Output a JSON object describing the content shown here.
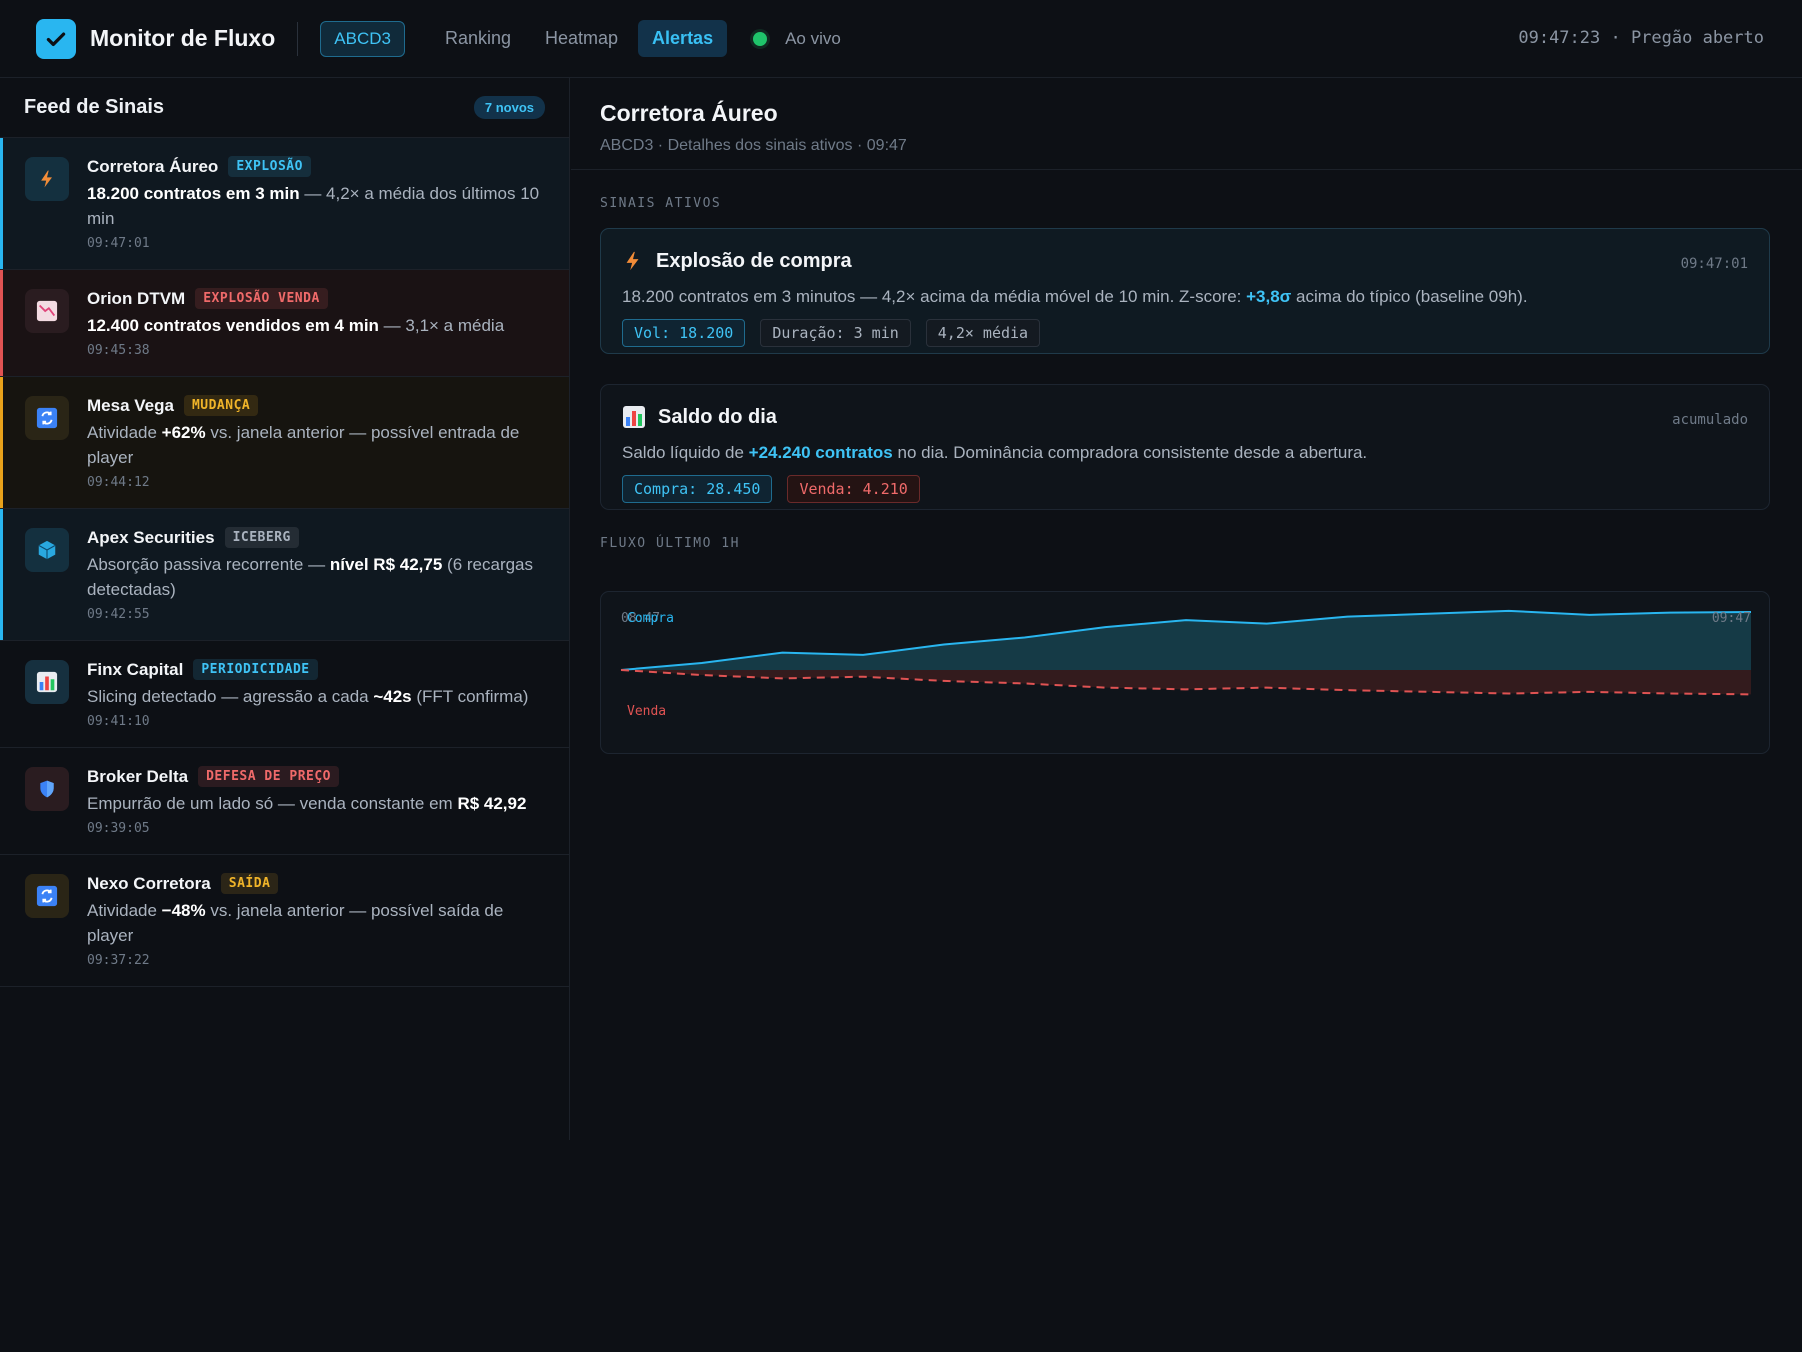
{
  "header": {
    "app_title": "Monitor de Fluxo",
    "ticker": "ABCD3",
    "nav": [
      "Ranking",
      "Heatmap",
      "Alertas"
    ],
    "active_nav": "Alertas",
    "live_label": "Ao vivo",
    "clock": "09:47:23 · Pregão aberto"
  },
  "feed": {
    "title": "Feed de Sinais",
    "new_badge": "7 novos",
    "items": [
      {
        "name": "Corretora Áureo",
        "tag": "EXPLOSÃO",
        "tag_color": "#3fc3f5",
        "accent": "#29b6f0",
        "icon": "lightning-icon",
        "pre": "",
        "bold": "18.200 contratos em 3 min",
        "post": " — 4,2× a média dos últimos 10 min",
        "time": "09:47:01"
      },
      {
        "name": "Orion DTVM",
        "tag": "EXPLOSÃO VENDA",
        "tag_color": "#f06a6a",
        "accent": "#e05353",
        "icon": "chart-down-icon",
        "pre": "",
        "bold": "12.400 contratos vendidos em 4 min",
        "post": " — 3,1× a média",
        "time": "09:45:38"
      },
      {
        "name": "Mesa Vega",
        "tag": "MUDANÇA",
        "tag_color": "#f0b429",
        "accent": "#e8a21b",
        "icon": "refresh-icon",
        "pre": "Atividade ",
        "bold": "+62%",
        "post": " vs. janela anterior — possível entrada de player",
        "time": "09:44:12"
      },
      {
        "name": "Apex Securities",
        "tag": "ICEBERG",
        "tag_color": "#aab3bf",
        "accent": "#29b6f0",
        "icon": "cube-icon",
        "pre": "Absorção passiva recorrente — ",
        "bold": "nível R$ 42,75",
        "post": " (6 recargas detectadas)",
        "time": "09:42:55"
      },
      {
        "name": "Finx Capital",
        "tag": "PERIODICIDADE",
        "tag_color": "#3fc3f5",
        "accent": "",
        "icon": "bar-chart-icon",
        "pre": "Slicing detectado — agressão a cada ",
        "bold": "~42s",
        "post": " (FFT confirma)",
        "time": "09:41:10"
      },
      {
        "name": "Broker Delta",
        "tag": "DEFESA DE PREÇO",
        "tag_color": "#f06a6a",
        "accent": "",
        "icon": "shield-icon",
        "pre": "Empurrão de um lado só — venda constante em ",
        "bold": "R$ 42,92",
        "post": "",
        "time": "09:39:05"
      },
      {
        "name": "Nexo Corretora",
        "tag": "SAÍDA",
        "tag_color": "#f0b429",
        "accent": "",
        "icon": "refresh-icon",
        "pre": "Atividade ",
        "bold": "−48%",
        "post": " vs. janela anterior — possível saída de player",
        "time": "09:37:22"
      }
    ]
  },
  "detail": {
    "title": "Corretora Áureo",
    "subtitle": "ABCD3 · Detalhes dos sinais ativos · 09:47",
    "section_active": "SINAIS ATIVOS",
    "card1": {
      "title": "Explosão de compra",
      "time": "09:47:01",
      "text_pre": "18.200 contratos em 3 minutos — 4,2× acima da média móvel de 10 min. Z-score: ",
      "text_bold": "+3,8σ",
      "text_post": " acima do típico (baseline 09h).",
      "chips": [
        "Vol: 18.200",
        "Duração: 3 min",
        "4,2× média"
      ]
    },
    "card2": {
      "title": "Saldo do dia",
      "time": "acumulado",
      "text_pre": "Saldo líquido de ",
      "text_bold": "+24.240 contratos",
      "text_post": " no dia. Dominância compradora consistente desde a abertura.",
      "chips": [
        "Compra: 28.450",
        "Venda: 4.210"
      ]
    },
    "section_flow": "FLUXO ÚLTIMO 1H"
  },
  "chart_data": {
    "type": "area",
    "x": [
      0,
      1,
      2,
      3,
      4,
      5,
      6,
      7,
      8,
      9,
      10,
      11,
      12,
      13,
      14
    ],
    "x_start_label": "08:47",
    "x_end_label": "09:47",
    "series": [
      {
        "name": "Compra",
        "color": "#29b6f0",
        "values": [
          0,
          0.12,
          0.3,
          0.26,
          0.44,
          0.56,
          0.74,
          0.86,
          0.8,
          0.92,
          0.97,
          1.02,
          0.95,
          0.99,
          1.0
        ]
      },
      {
        "name": "Venda",
        "color": "#e05353",
        "values": [
          0,
          -0.12,
          -0.2,
          -0.16,
          -0.26,
          -0.32,
          -0.42,
          -0.46,
          -0.42,
          -0.48,
          -0.52,
          -0.56,
          -0.52,
          -0.56,
          -0.58
        ]
      }
    ],
    "ylim": [
      -1,
      1.1
    ],
    "grid": false
  }
}
